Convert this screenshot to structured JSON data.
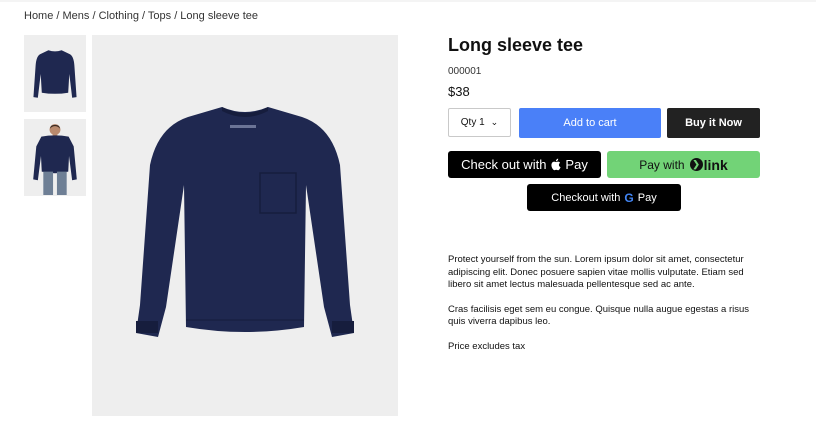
{
  "breadcrumb": "Home / Mens / Clothing / Tops / Long sleeve tee",
  "product": {
    "title": "Long sleeve tee",
    "sku": "000001",
    "price": "$38",
    "qty_label": "Qty 1",
    "description": [
      "Protect yourself from the sun. Lorem ipsum dolor sit amet, consectetur adipiscing elit. Donec posuere sapien vitae mollis vulputate. Etiam sed libero sit amet lectus malesuada pellentesque sed ac ante.",
      "Cras facilisis eget sem eu congue. Quisque nulla augue egestas a risus quis viverra dapibus leo.",
      "Price excludes tax"
    ]
  },
  "buttons": {
    "add_to_cart": "Add to cart",
    "buy_now": "Buy it Now",
    "apple_pay_prefix": "Check out with",
    "apple_pay_brand": "Pay",
    "link_prefix": "Pay with",
    "link_brand": "link",
    "gpay_prefix": "Checkout with",
    "gpay_brand": "Pay",
    "gpay_g": "G"
  },
  "icons": {
    "qty_chevron": "chevron-down-icon",
    "apple": "apple-icon",
    "link_logo": "link-logo-icon",
    "google": "google-g-icon"
  },
  "colors": {
    "add_to_cart": "#4a80f8",
    "buy_now": "#222222",
    "link_green": "#72d377",
    "shirt_navy": "#1f2850",
    "image_bg": "#eeeeee"
  }
}
